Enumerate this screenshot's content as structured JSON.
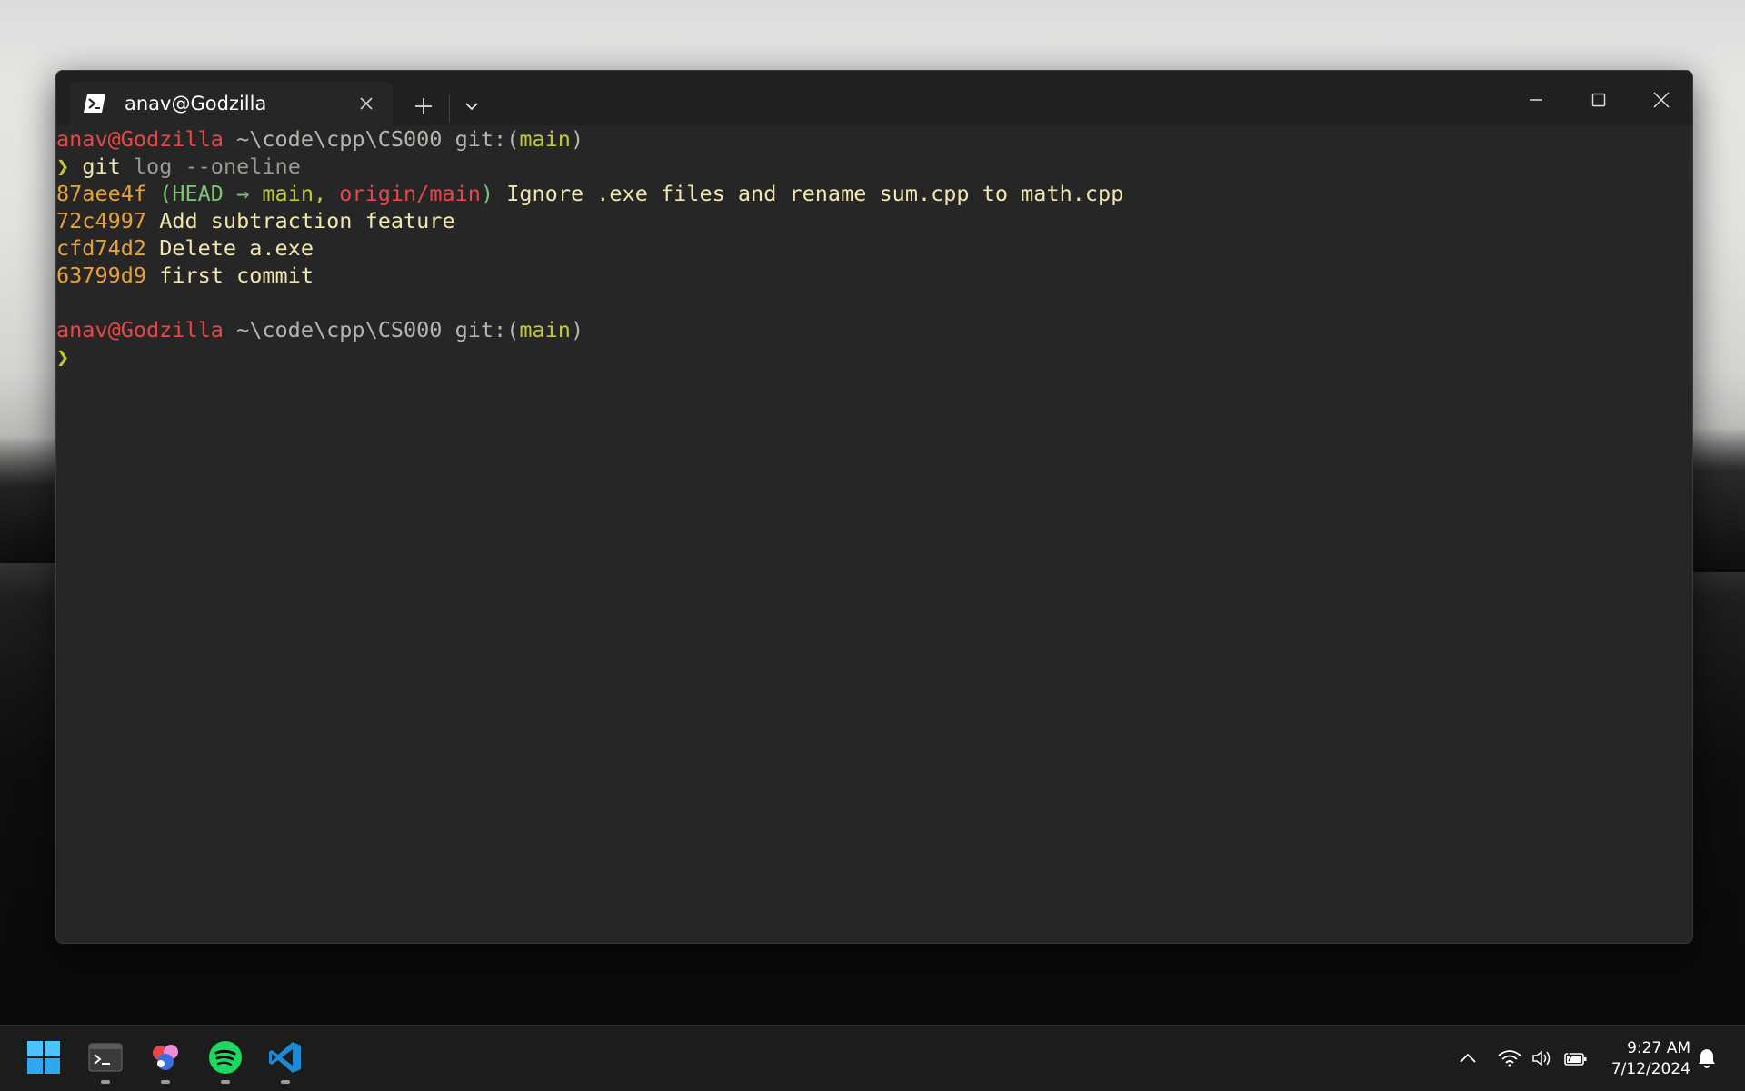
{
  "window": {
    "tab_title": "anav@Godzilla"
  },
  "terminal": {
    "prompt1": {
      "user": "anav@Godzilla",
      "path": " ~\\code\\cpp\\CS000",
      "git_prefix": " git:(",
      "branch": "main",
      "git_suffix": ")"
    },
    "command": {
      "prompt_symbol": "❯",
      "cmd": "git",
      "args": " log --oneline"
    },
    "log": [
      {
        "hash": "87aee4f",
        "refs_open": " (",
        "head": "HEAD → ",
        "main": "main, ",
        "origin": "origin/main",
        "refs_close": ")",
        "msg": " Ignore .exe files and rename sum.cpp to math.cpp"
      },
      {
        "hash": "72c4997",
        "msg": " Add subtraction feature"
      },
      {
        "hash": "cfd74d2",
        "msg": " Delete a.exe"
      },
      {
        "hash": "63799d9",
        "msg": " first commit"
      }
    ],
    "prompt2": {
      "user": "anav@Godzilla",
      "path": " ~\\code\\cpp\\CS000",
      "git_prefix": " git:(",
      "branch": "main",
      "git_suffix": ")",
      "prompt_symbol": "❯"
    }
  },
  "taskbar": {
    "time": "9:27 AM",
    "date": "7/12/2024",
    "apps": [
      "start-icon",
      "terminal-icon",
      "paint-app-icon",
      "spotify-icon",
      "vscode-icon"
    ]
  },
  "colors": {
    "window_bg": "#262626",
    "titlebar_bg": "#202020",
    "user_red": "#e8474a",
    "branch_yellow": "#c2c83a",
    "hash_orange": "#e5a23c",
    "head_green": "#7ec27a"
  }
}
